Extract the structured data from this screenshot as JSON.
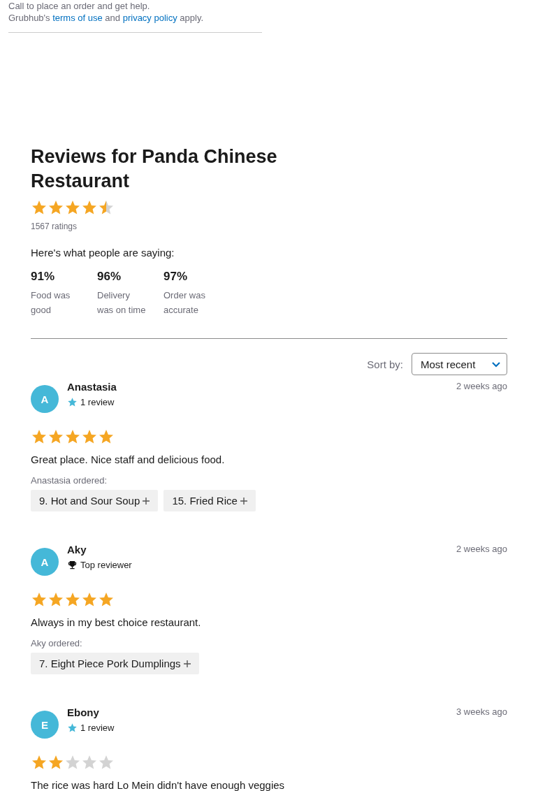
{
  "help_text": "Call to place an order and get help.",
  "legal": {
    "prefix": "Grubhub's",
    "terms_link": "terms of use",
    "joiner": "and",
    "privacy_link": "privacy policy",
    "suffix": "apply."
  },
  "reviews_header": {
    "title": "Reviews for Panda Chinese Restaurant",
    "stars": 4.5,
    "ratings_count": "1567 ratings",
    "saying": "Here's what people are saying:",
    "stats": [
      {
        "value": "91%",
        "label": "Food was good"
      },
      {
        "value": "96%",
        "label": "Delivery was on time"
      },
      {
        "value": "97%",
        "label": "Order was accurate"
      }
    ]
  },
  "sort": {
    "label": "Sort by:",
    "value": "Most recent"
  },
  "reviews": [
    {
      "initial": "A",
      "name": "Anastasia",
      "badge": {
        "kind": "reviews",
        "text": "1 review"
      },
      "time": "2 weeks ago",
      "stars": 5,
      "text": "Great place. Nice staff and delicious food.",
      "ordered_label": "Anastasia ordered:",
      "items": [
        "9. Hot and Sour Soup",
        "15. Fried Rice"
      ]
    },
    {
      "initial": "A",
      "name": "Aky",
      "badge": {
        "kind": "top",
        "text": "Top reviewer"
      },
      "time": "2 weeks ago",
      "stars": 5,
      "text": "Always in my best choice restaurant.",
      "ordered_label": "Aky ordered:",
      "items": [
        "7. Eight Piece Pork Dumplings"
      ]
    },
    {
      "initial": "E",
      "name": "Ebony",
      "badge": {
        "kind": "reviews",
        "text": "1 review"
      },
      "time": "3 weeks ago",
      "stars": 2,
      "text": "The rice was hard Lo Mein didn't have enough veggies"
    }
  ]
}
